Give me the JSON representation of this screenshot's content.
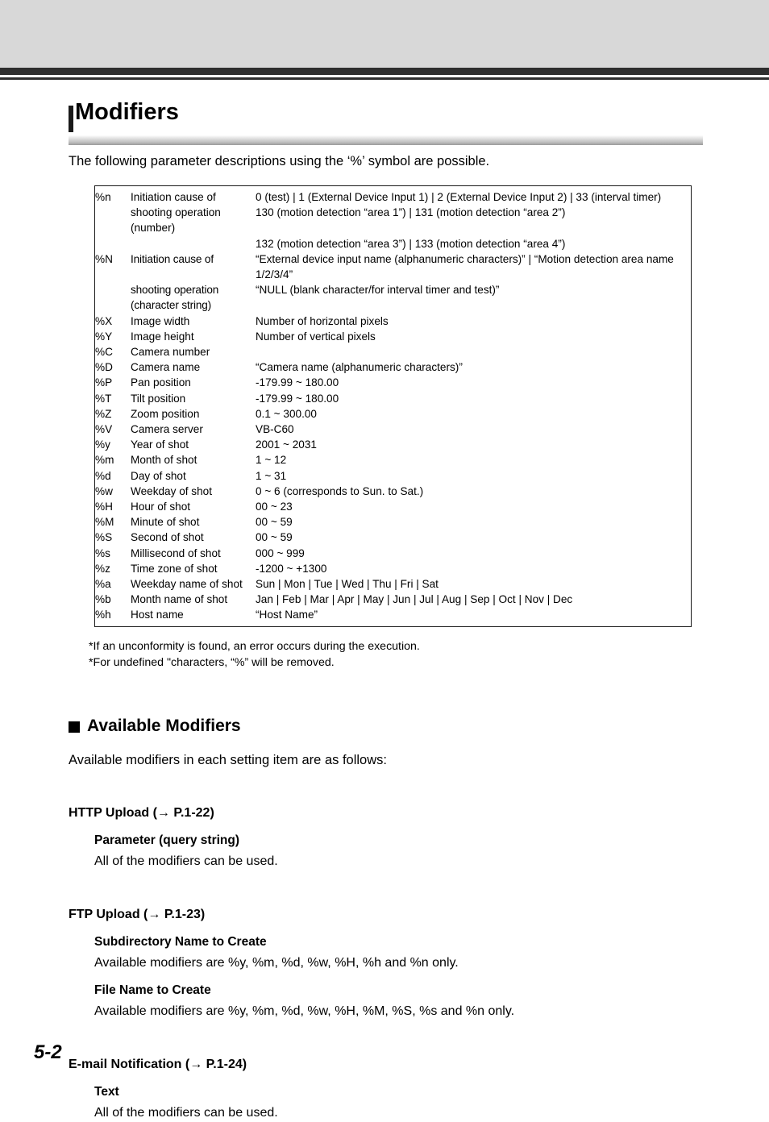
{
  "header": {
    "band_color": "#d8d8d8",
    "bar_color": "#2e2e2e"
  },
  "title": "Modifiers",
  "intro": "The following parameter descriptions using the ‘%’ symbol are possible.",
  "table": {
    "rows": [
      {
        "code": "%n",
        "desc": "Initiation cause of",
        "value": "0 (test) | 1 (External Device Input 1) | 2 (External Device Input 2) | 33 (interval timer)",
        "condensed": false
      },
      {
        "code": "",
        "desc": "shooting operation (number)",
        "value": "130 (motion detection “area 1”) | 131 (motion detection “area 2”)",
        "condensed": false
      },
      {
        "code": "",
        "desc": "",
        "value": "132 (motion detection “area 3”) | 133 (motion detection “area 4”)",
        "condensed": false
      },
      {
        "code": "%N",
        "desc": "Initiation cause of",
        "value": "“External device input name (alphanumeric characters)” | “Motion detection area name 1/2/3/4”",
        "condensed": true
      },
      {
        "code": "",
        "desc": "shooting operation (character string)",
        "value": "“NULL (blank character/for interval timer and test)”",
        "condensed": true
      },
      {
        "code": "%X",
        "desc": "Image width",
        "value": "Number of horizontal pixels",
        "condensed": false
      },
      {
        "code": "%Y",
        "desc": "Image height",
        "value": "Number of vertical pixels",
        "condensed": false
      },
      {
        "code": "%C",
        "desc": "Camera number",
        "value": "",
        "condensed": false
      },
      {
        "code": "%D",
        "desc": "Camera name",
        "value": "“Camera name (alphanumeric characters)”",
        "condensed": false
      },
      {
        "code": "%P",
        "desc": "Pan position",
        "value": "-179.99 ~ 180.00",
        "condensed": false
      },
      {
        "code": "%T",
        "desc": "Tilt position",
        "value": "-179.99 ~ 180.00",
        "condensed": false
      },
      {
        "code": "%Z",
        "desc": "Zoom position",
        "value": "0.1 ~ 300.00",
        "condensed": false
      },
      {
        "code": "%V",
        "desc": "Camera server",
        "value": "VB-C60",
        "condensed": false
      },
      {
        "code": "%y",
        "desc": "Year of shot",
        "value": "2001 ~ 2031",
        "condensed": false
      },
      {
        "code": "%m",
        "desc": "Month of shot",
        "value": "1 ~ 12",
        "condensed": false
      },
      {
        "code": "%d",
        "desc": "Day of shot",
        "value": "1 ~ 31",
        "condensed": false
      },
      {
        "code": "%w",
        "desc": "Weekday of shot",
        "value": "0 ~ 6 (corresponds to Sun. to Sat.)",
        "condensed": false
      },
      {
        "code": "%H",
        "desc": "Hour of shot",
        "value": "00 ~ 23",
        "condensed": false
      },
      {
        "code": "%M",
        "desc": "Minute of shot",
        "value": "00 ~ 59",
        "condensed": false
      },
      {
        "code": "%S",
        "desc": "Second of shot",
        "value": "00 ~ 59",
        "condensed": false
      },
      {
        "code": "%s",
        "desc": "Millisecond of shot",
        "value": "000 ~ 999",
        "condensed": false
      },
      {
        "code": "%z",
        "desc": "Time zone of shot",
        "value": "-1200 ~ +1300",
        "condensed": false
      },
      {
        "code": "%a",
        "desc": "Weekday name of shot",
        "value": "Sun | Mon | Tue | Wed | Thu | Fri | Sat",
        "condensed": false
      },
      {
        "code": "%b",
        "desc": "Month name of shot",
        "value": "Jan | Feb | Mar | Apr | May | Jun | Jul | Aug | Sep | Oct | Nov | Dec",
        "condensed": false
      },
      {
        "code": "%h",
        "desc": "Host name",
        "value": "“Host Name”",
        "condensed": false
      }
    ]
  },
  "footnotes": [
    "*If an unconformity is found, an error occurs during the execution.",
    "*For undefined \"characters, “%” will be removed."
  ],
  "section": {
    "heading": "Available Modifiers",
    "intro": "Available modifiers in each setting item are as follows:"
  },
  "groups": [
    {
      "title": "HTTP Upload (→ P.1-22)",
      "items": [
        {
          "title": "Parameter (query string)",
          "body": "All of the modifiers can be used."
        }
      ]
    },
    {
      "title": "FTP Upload (→ P.1-23)",
      "items": [
        {
          "title": "Subdirectory Name to Create",
          "body": "Available modifiers are %y, %m, %d, %w, %H, %h and %n only."
        },
        {
          "title": "File Name to Create",
          "body": "Available modifiers are %y, %m, %d, %w, %H, %M, %S, %s and %n only."
        }
      ]
    },
    {
      "title": "E-mail Notification (→ P.1-24)",
      "items": [
        {
          "title": "Text",
          "body": "All of the modifiers can be used."
        }
      ]
    }
  ],
  "page_number": "5-2"
}
